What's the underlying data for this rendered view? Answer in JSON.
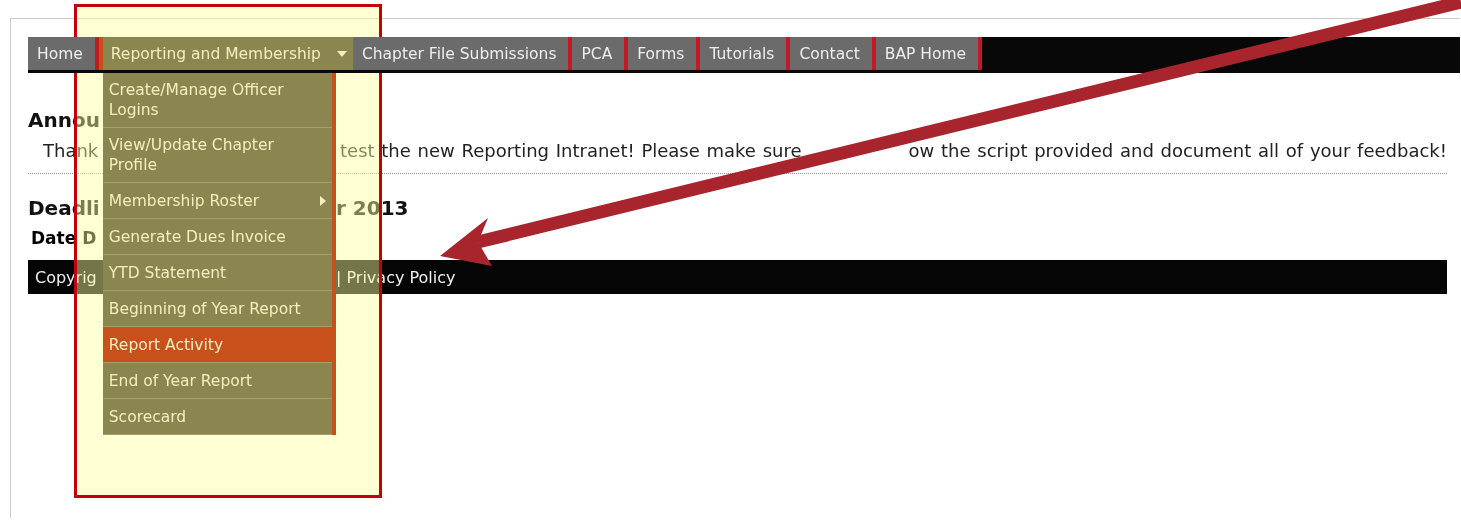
{
  "nav": [
    {
      "label": "Home",
      "selected": false,
      "has_dropdown": false
    },
    {
      "label": "Reporting and Membership",
      "selected": true,
      "has_dropdown": true
    },
    {
      "label": "Chapter File Submissions",
      "selected": false,
      "has_dropdown": false
    },
    {
      "label": "PCA",
      "selected": false,
      "has_dropdown": false
    },
    {
      "label": "Forms",
      "selected": false,
      "has_dropdown": false
    },
    {
      "label": "Tutorials",
      "selected": false,
      "has_dropdown": false
    },
    {
      "label": "Contact",
      "selected": false,
      "has_dropdown": false
    },
    {
      "label": "BAP Home",
      "selected": false,
      "has_dropdown": false
    }
  ],
  "menu": [
    {
      "label": "Create/Manage Officer Logins",
      "selected": false,
      "has_submenu": false
    },
    {
      "label": "View/Update Chapter Profile",
      "selected": false,
      "has_submenu": false
    },
    {
      "label": "Membership Roster",
      "selected": false,
      "has_submenu": true
    },
    {
      "label": "Generate Dues Invoice",
      "selected": false,
      "has_submenu": false
    },
    {
      "label": "YTD Statement",
      "selected": false,
      "has_submenu": false
    },
    {
      "label": "Beginning of Year Report",
      "selected": false,
      "has_submenu": false
    },
    {
      "label": "Report Activity",
      "selected": true,
      "has_submenu": false
    },
    {
      "label": "End of Year Report",
      "selected": false,
      "has_submenu": false
    },
    {
      "label": "Scorecard",
      "selected": false,
      "has_submenu": false
    }
  ],
  "announcements": {
    "heading_left": "Annou",
    "text_left": "Thank",
    "text_right": [
      "test the new Reporting Intranet! Please make sure",
      "ow the script provided and document all of your feedback!"
    ]
  },
  "deadlines": {
    "heading_left": "Deadli",
    "heading_right": "r 2013",
    "subheading_left": "Date D"
  },
  "footer": {
    "text_left": "Copyrig",
    "text_right": "| Privacy Policy"
  }
}
